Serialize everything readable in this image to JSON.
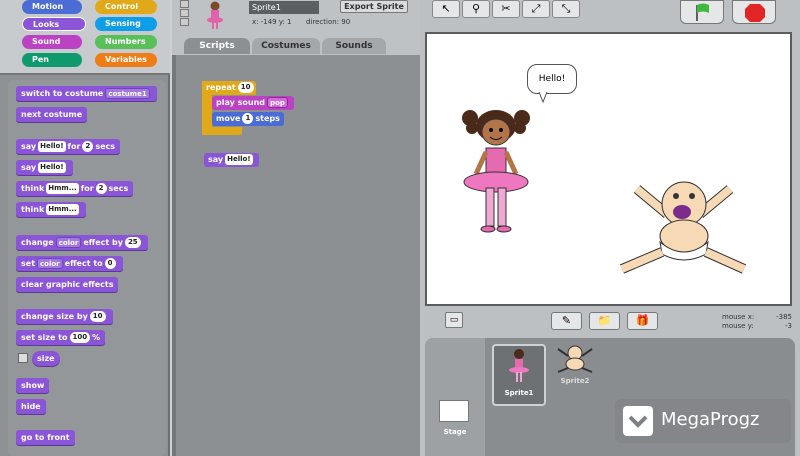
{
  "categories": [
    {
      "label": "Motion",
      "color": "#4a6cd4"
    },
    {
      "label": "Control",
      "color": "#e1a91a"
    },
    {
      "label": "Looks",
      "color": "#8a55d7"
    },
    {
      "label": "Sensing",
      "color": "#0e9ee8"
    },
    {
      "label": "Sound",
      "color": "#bb42c3"
    },
    {
      "label": "Numbers",
      "color": "#59c059"
    },
    {
      "label": "Pen",
      "color": "#0e9a6c"
    },
    {
      "label": "Variables",
      "color": "#ee7d16"
    }
  ],
  "palette": {
    "switch_costume": "switch to costume",
    "costume_value": "costume1",
    "next_costume": "next costume",
    "say_for": "say",
    "say_for_text": "Hello!",
    "for_label": "for",
    "say_for_secs": "2",
    "secs_label": "secs",
    "say": "say",
    "say_text": "Hello!",
    "think_for": "think",
    "think_for_text": "Hmm...",
    "think_for_secs": "2",
    "think": "think",
    "think_text": "Hmm...",
    "change_effect": "change",
    "effect_name": "color",
    "effect_by": "effect by",
    "effect_by_value": "25",
    "set_effect": "set",
    "set_effect_name": "color",
    "effect_to": "effect to",
    "effect_to_value": "0",
    "clear_effects": "clear graphic effects",
    "change_size": "change size by",
    "change_size_value": "10",
    "set_size": "set size to",
    "set_size_value": "100",
    "percent": "%",
    "size": "size",
    "show": "show",
    "hide": "hide",
    "go_front": "go to front"
  },
  "sprite_header": {
    "name": "Sprite1",
    "export_label": "Export Sprite",
    "coords": "x: -149  y: 1",
    "direction": "direction: 90"
  },
  "tabs": [
    "Scripts",
    "Costumes",
    "Sounds"
  ],
  "script": {
    "repeat": "repeat",
    "repeat_count": "10",
    "play_sound": "play sound",
    "sound_name": "pop",
    "move": "move",
    "move_steps": "1",
    "steps": "steps",
    "say": "say",
    "say_text": "Hello!"
  },
  "stage": {
    "speech": "Hello!"
  },
  "mouse": {
    "x_label": "mouse x:",
    "x_value": "-385",
    "y_label": "mouse y:",
    "y_value": "-3"
  },
  "sprites": [
    {
      "name": "Sprite1",
      "selected": true
    },
    {
      "name": "Sprite2",
      "selected": false
    }
  ],
  "stage_label": "Stage",
  "watermark": "MegaProgz"
}
